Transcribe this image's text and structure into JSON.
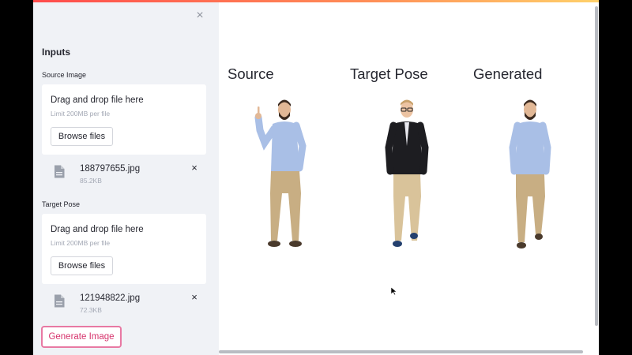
{
  "sidebar": {
    "header": "Inputs",
    "source": {
      "label": "Source Image",
      "drop_title": "Drag and drop file here",
      "limit": "Limit 200MB per file",
      "browse": "Browse files",
      "file_name": "188797655.jpg",
      "file_size": "85.2KB"
    },
    "target": {
      "label": "Target Pose",
      "drop_title": "Drag and drop file here",
      "limit": "Limit 200MB per file",
      "browse": "Browse files",
      "file_name": "121948822.jpg",
      "file_size": "72.3KB"
    },
    "generate": "Generate Image",
    "close_symbol": "×",
    "remove_symbol": "×"
  },
  "main": {
    "columns": [
      {
        "title": "Source"
      },
      {
        "title": "Target Pose"
      },
      {
        "title": "Generated"
      }
    ]
  },
  "colors": {
    "accent": "#ff4b4b",
    "generate_border": "#e879a3",
    "generate_text": "#d6336c",
    "sidebar_bg": "#f0f2f6",
    "shirt_blue": "#a9bfe6",
    "pants_khaki": "#c8ae83",
    "cardigan_black": "#1d1d21"
  },
  "icons": [
    "close-icon",
    "file-icon",
    "remove-file-icon",
    "mouse-cursor-icon"
  ]
}
